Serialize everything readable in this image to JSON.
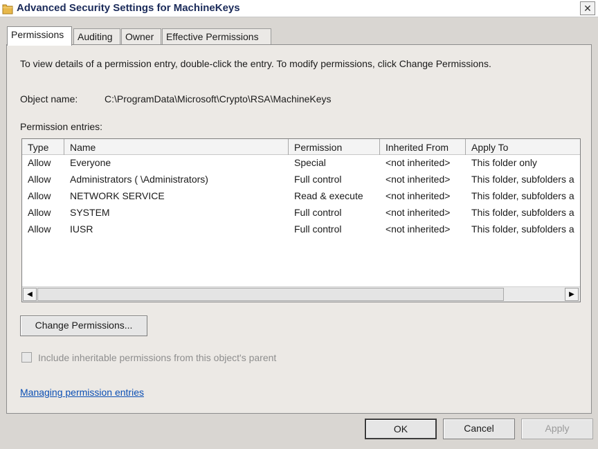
{
  "window": {
    "title": "Advanced Security Settings for MachineKeys",
    "close_glyph": "✕",
    "icon": "folder-icon"
  },
  "tabs": [
    {
      "label": "Permissions",
      "active": true
    },
    {
      "label": "Auditing",
      "active": false
    },
    {
      "label": "Owner",
      "active": false
    },
    {
      "label": "Effective Permissions",
      "active": false
    }
  ],
  "permissions_tab": {
    "instructions": "To view details of a permission entry, double-click the entry. To modify permissions, click Change Permissions.",
    "object_name_label": "Object name:",
    "object_name_value": "C:\\ProgramData\\Microsoft\\Crypto\\RSA\\MachineKeys",
    "entries_label": "Permission entries:",
    "columns": [
      "Type",
      "Name",
      "Permission",
      "Inherited From",
      "Apply To"
    ],
    "rows": [
      [
        "Allow",
        "Everyone",
        "Special",
        "<not inherited>",
        "This folder only"
      ],
      [
        "Allow",
        "Administrators (                    \\Administrators)",
        "Full control",
        "<not inherited>",
        "This folder, subfolders a"
      ],
      [
        "Allow",
        "NETWORK SERVICE",
        "Read & execute",
        "<not inherited>",
        "This folder, subfolders a"
      ],
      [
        "Allow",
        "SYSTEM",
        "Full control",
        "<not inherited>",
        "This folder, subfolders a"
      ],
      [
        "Allow",
        "IUSR",
        "Full control",
        "<not inherited>",
        "This folder, subfolders a"
      ]
    ],
    "scroll_left": "◀",
    "scroll_right": "▶",
    "change_permissions_label": "Change Permissions...",
    "include_inheritable_label": "Include inheritable permissions from this object's parent",
    "include_inheritable_checked": false,
    "managing_link": "Managing permission entries"
  },
  "footer": {
    "ok_label": "OK",
    "cancel_label": "Cancel",
    "apply_label": "Apply"
  }
}
